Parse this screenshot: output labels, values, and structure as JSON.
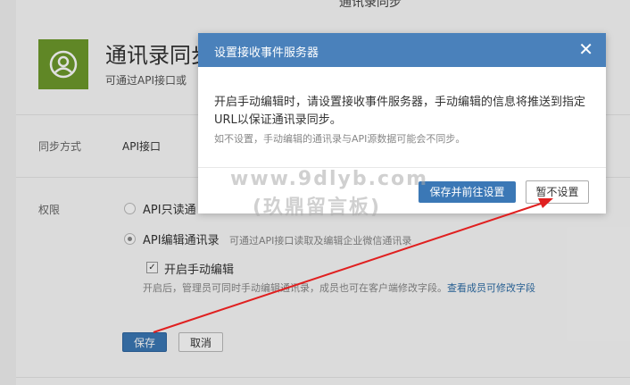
{
  "page": {
    "top_title": "通讯录同步",
    "app_title": "通讯录同步",
    "app_desc": "可通过API接口或",
    "sync_method_label": "同步方式",
    "sync_method_value": "API接口",
    "permission_label": "权限",
    "radio_readonly": "API只读通",
    "radio_edit": "API编辑通讯录",
    "radio_edit_hint": "可通过API接口读取及编辑企业微信通讯录",
    "checkbox_manual_label": "开启手动编辑",
    "checkbox_manual_hint": "开启后，管理员可同时手动编辑通讯录，成员也可在客户端修改字段。",
    "hint_link": "查看成员可修改字段",
    "save_label": "保存",
    "cancel_label": "取消"
  },
  "modal": {
    "title": "设置接收事件服务器",
    "close": "✕",
    "body": "开启手动编辑时，请设置接收事件服务器，手动编辑的信息将推送到指定URL以保证通讯录同步。",
    "note": "如不设置，手动编辑的通讯录与API源数据可能会不同步。",
    "primary_label": "保存并前往设置",
    "secondary_label": "暂不设置"
  },
  "watermark": {
    "line1": "www.9dlyb.com",
    "line2": "(玖鼎留言板)"
  },
  "colors": {
    "header_blue": "#4a81bb",
    "primary_blue": "#3b78b6",
    "app_icon_green": "#6e9a2c",
    "annotation_red": "#e02020"
  }
}
